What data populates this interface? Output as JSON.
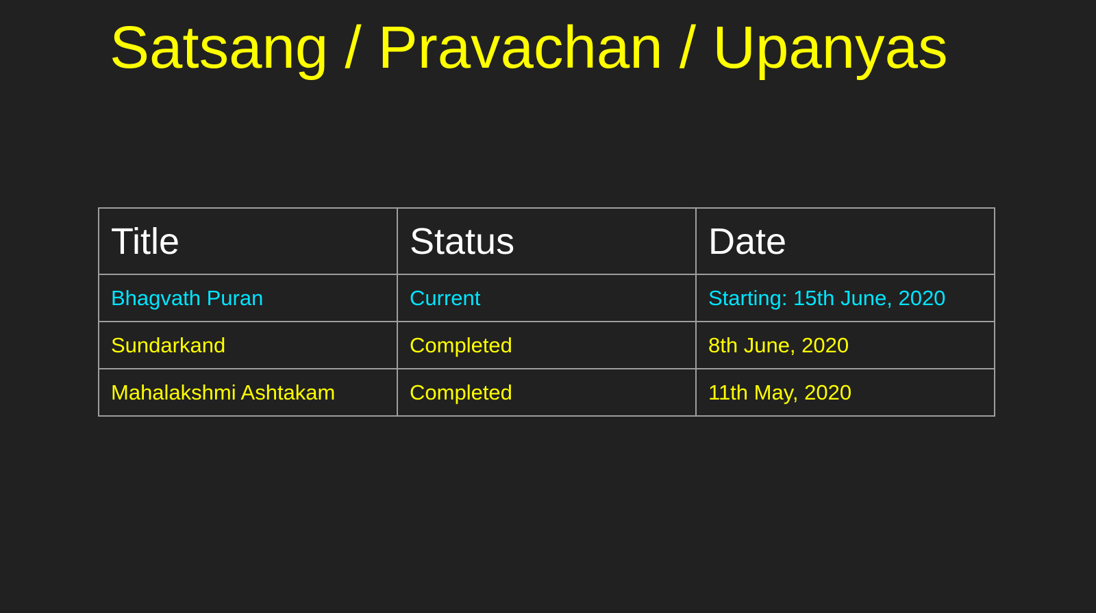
{
  "page": {
    "title": "Satsang / Pravachan / Upanyas"
  },
  "colors": {
    "background": "#212121",
    "title": "#ffff00",
    "header_text": "#ffffff",
    "current_row": "#00e5ff",
    "completed_row": "#ffff00",
    "border": "#9e9e9e"
  },
  "table": {
    "columns": [
      "Title",
      "Status",
      "Date"
    ],
    "rows": [
      [
        "Bhagvath Puran",
        "Current",
        "Starting: 15th June, 2020"
      ],
      [
        "Sundarkand",
        "Completed",
        "8th June, 2020"
      ],
      [
        "Mahalakshmi Ashtakam",
        "Completed",
        "11th May, 2020"
      ]
    ]
  }
}
